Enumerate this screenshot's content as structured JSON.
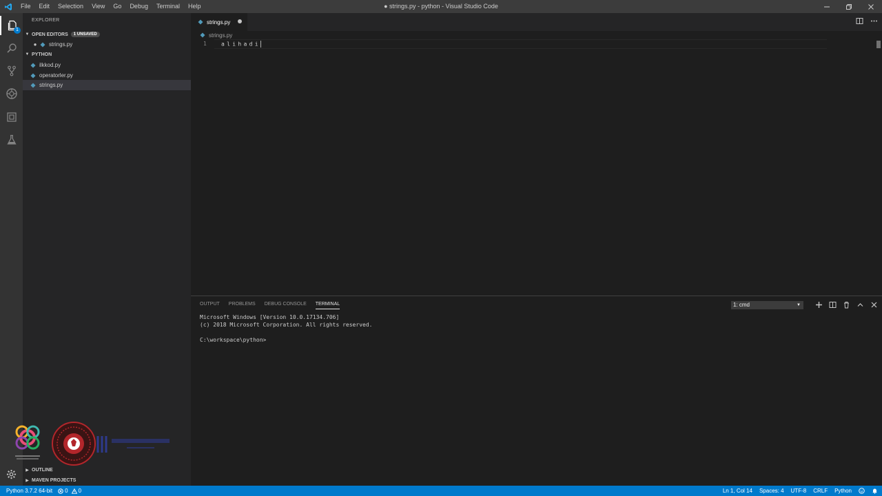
{
  "window": {
    "title": "● strings.py - python - Visual Studio Code",
    "menu": [
      "File",
      "Edit",
      "Selection",
      "View",
      "Go",
      "Debug",
      "Terminal",
      "Help"
    ]
  },
  "activity": {
    "explorer_badge": "1"
  },
  "sidebar": {
    "title": "EXPLORER",
    "open_editors": {
      "label": "OPEN EDITORS",
      "badge": "1 UNSAVED",
      "files": [
        "strings.py"
      ]
    },
    "folder": {
      "label": "PYTHON",
      "files": [
        "ilkkod.py",
        "operatorler.py",
        "strings.py"
      ]
    },
    "outline_label": "OUTLINE",
    "maven_label": "MAVEN PROJECTS"
  },
  "editor": {
    "tab_label": "strings.py",
    "breadcrumb": "strings.py",
    "line_number": "1",
    "code": "alihadi"
  },
  "panel": {
    "tabs": [
      "OUTPUT",
      "PROBLEMS",
      "DEBUG CONSOLE",
      "TERMINAL"
    ],
    "active_tab": "TERMINAL",
    "terminal_select": "1: cmd",
    "output": "Microsoft Windows [Version 10.0.17134.706]\n(c) 2018 Microsoft Corporation. All rights reserved.\n\nC:\\workspace\\python>"
  },
  "status": {
    "interpreter": "Python 3.7.2 64-bit",
    "errors": "0",
    "warnings": "0",
    "position": "Ln 1, Col 14",
    "spaces": "Spaces: 4",
    "encoding": "UTF-8",
    "eol": "CRLF",
    "language": "Python"
  },
  "colors": {
    "accent": "#007acc",
    "python_icon": "#519aba"
  }
}
